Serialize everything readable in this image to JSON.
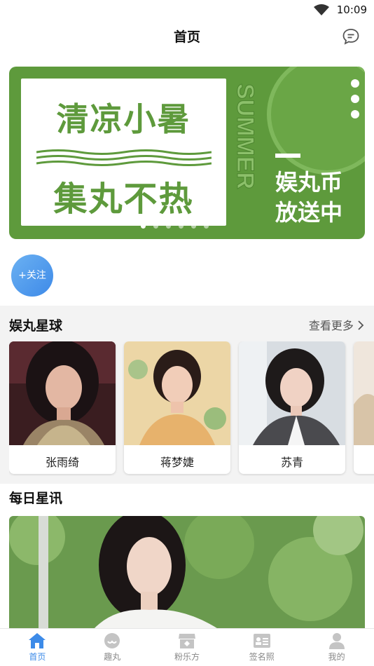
{
  "status_bar": {
    "time": "10:09",
    "icons": [
      "wifi-icon"
    ]
  },
  "nav": {
    "title": "首页",
    "right_icon": "message-icon"
  },
  "banner": {
    "line1": "清凉小暑",
    "line2": "集丸不热",
    "vertical_text": "SUMMER",
    "coin_line1": "娱丸币",
    "coin_line2": "放送中",
    "colors": {
      "green": "#5e9a3c",
      "light_green": "#7fb85c",
      "white": "#ffffff"
    },
    "page_count": 6,
    "current_page": 1
  },
  "follow_button": {
    "label": "+关注"
  },
  "star_section": {
    "title": "娱丸星球",
    "more_label": "查看更多",
    "cards": [
      {
        "name": "张雨绮"
      },
      {
        "name": "蒋梦婕"
      },
      {
        "name": "苏青"
      }
    ]
  },
  "news_section": {
    "title": "每日星讯"
  },
  "tabbar": {
    "items": [
      {
        "label": "首页",
        "icon": "home-icon",
        "active": true
      },
      {
        "label": "趣丸",
        "icon": "chat-bubble-icon",
        "active": false
      },
      {
        "label": "粉乐方",
        "icon": "shop-icon",
        "active": false
      },
      {
        "label": "签名照",
        "icon": "id-card-icon",
        "active": false
      },
      {
        "label": "我的",
        "icon": "user-icon",
        "active": false
      }
    ],
    "active_color": "#3d8be8",
    "inactive_color": "#b8b8b8"
  }
}
